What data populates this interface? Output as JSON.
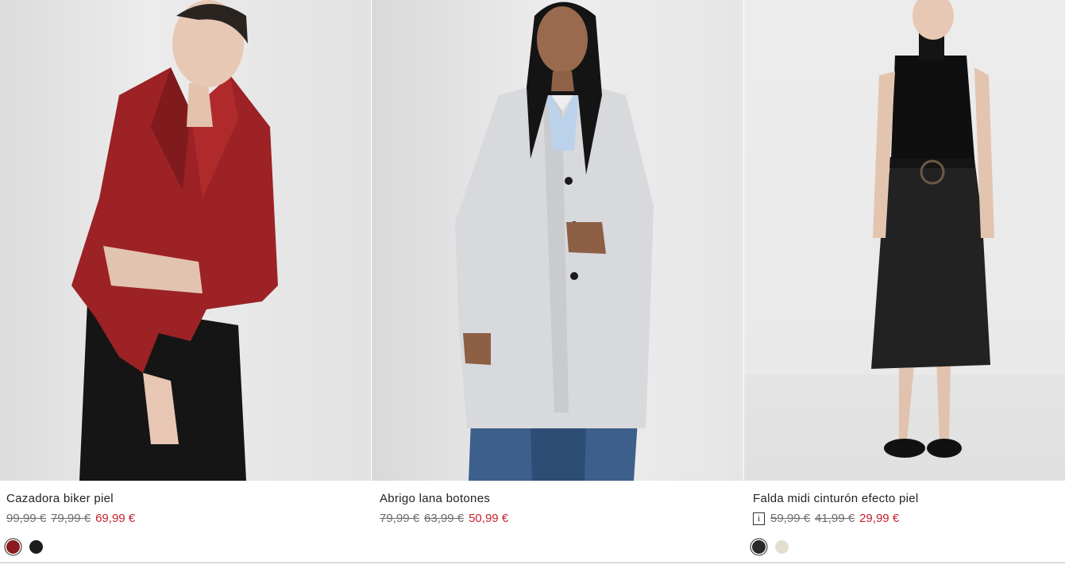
{
  "products": [
    {
      "image_alt": "Cazadora biker piel",
      "name": "Cazadora biker piel",
      "prices": [
        "99,99 €",
        "79,99 €"
      ],
      "sale_price": "69,99 €",
      "colors": [
        {
          "name": "red-swatch",
          "hex": "#8b1b1f",
          "selected": true
        },
        {
          "name": "black-swatch",
          "hex": "#1c1c1c",
          "selected": false
        }
      ]
    },
    {
      "image_alt": "Abrigo lana botones",
      "name": "Abrigo lana botones",
      "prices": [
        "79,99 €",
        "63,99 €"
      ],
      "sale_price": "50,99 €",
      "colors": []
    },
    {
      "image_alt": "Falda midi cinturón efecto piel",
      "name": "Falda midi cinturón efecto piel",
      "info_icon": "i",
      "prices": [
        "59,99 €",
        "41,99 €"
      ],
      "sale_price": "29,99 €",
      "colors": [
        {
          "name": "black-swatch",
          "hex": "#2a2a2a",
          "selected": true
        },
        {
          "name": "cream-swatch",
          "hex": "#e3dfcf",
          "selected": false
        }
      ]
    }
  ],
  "theme": {
    "sale_color": "#c8202f",
    "old_price_color": "#6d6d6d"
  }
}
